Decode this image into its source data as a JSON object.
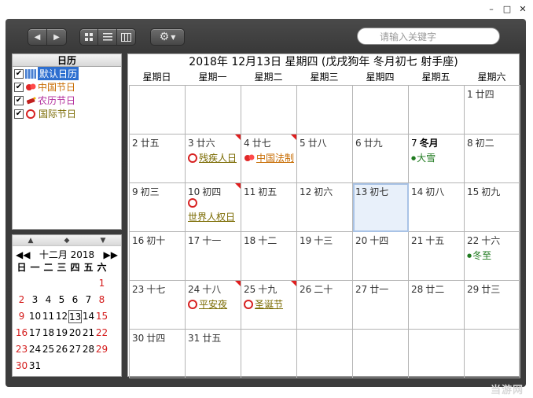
{
  "window": {
    "controls": [
      "–",
      "□",
      "✕"
    ]
  },
  "toolbar": {
    "search_placeholder": "请输入关键字"
  },
  "calendars": {
    "header": "日历",
    "items": [
      {
        "label": "默认日历",
        "color": "#ffffff",
        "selected": true
      },
      {
        "label": "中国节日",
        "color": "#c76b00",
        "selected": false
      },
      {
        "label": "农历节日",
        "color": "#b3309e",
        "selected": false
      },
      {
        "label": "国际节日",
        "color": "#7a6a00",
        "selected": false
      }
    ]
  },
  "mini_calendar": {
    "month_label": "十二月 2018",
    "weekdays": [
      "日",
      "一",
      "二",
      "三",
      "四",
      "五",
      "六"
    ],
    "rows": [
      [
        "",
        "",
        "",
        "",
        "",
        "",
        "1"
      ],
      [
        "2",
        "3",
        "4",
        "5",
        "6",
        "7",
        "8"
      ],
      [
        "9",
        "10",
        "11",
        "12",
        "13",
        "14",
        "15"
      ],
      [
        "16",
        "17",
        "18",
        "19",
        "20",
        "21",
        "22"
      ],
      [
        "23",
        "24",
        "25",
        "26",
        "27",
        "28",
        "29"
      ],
      [
        "30",
        "31",
        "",
        "",
        "",
        "",
        ""
      ]
    ]
  },
  "main": {
    "title": "2018年 12月13日 星期四 (戊戌狗年 冬月初七 射手座)",
    "weekdays": [
      "星期日",
      "星期一",
      "星期二",
      "星期三",
      "星期四",
      "星期五",
      "星期六"
    ],
    "weeks": [
      [
        {
          "d": ""
        },
        {
          "d": ""
        },
        {
          "d": ""
        },
        {
          "d": ""
        },
        {
          "d": ""
        },
        {
          "d": ""
        },
        {
          "d": "1",
          "l": "廿四"
        }
      ],
      [
        {
          "d": "2",
          "l": "廿五"
        },
        {
          "d": "3",
          "l": "廿六",
          "event": "残疾人日",
          "etype": "intl",
          "corner": true
        },
        {
          "d": "4",
          "l": "廿七",
          "event": "中国法制",
          "etype": "cn",
          "corner": true
        },
        {
          "d": "5",
          "l": "廿八"
        },
        {
          "d": "6",
          "l": "廿九"
        },
        {
          "d": "7",
          "l": "冬月",
          "bold": true,
          "event": "大雪",
          "etype": "term"
        },
        {
          "d": "8",
          "l": "初二"
        }
      ],
      [
        {
          "d": "9",
          "l": "初三"
        },
        {
          "d": "10",
          "l": "初四",
          "event": "世界人权日",
          "etype": "intl2",
          "corner": true
        },
        {
          "d": "11",
          "l": "初五"
        },
        {
          "d": "12",
          "l": "初六"
        },
        {
          "d": "13",
          "l": "初七",
          "today": true
        },
        {
          "d": "14",
          "l": "初八"
        },
        {
          "d": "15",
          "l": "初九"
        }
      ],
      [
        {
          "d": "16",
          "l": "初十"
        },
        {
          "d": "17",
          "l": "十一"
        },
        {
          "d": "18",
          "l": "十二"
        },
        {
          "d": "19",
          "l": "十三"
        },
        {
          "d": "20",
          "l": "十四"
        },
        {
          "d": "21",
          "l": "十五"
        },
        {
          "d": "22",
          "l": "十六",
          "event": "冬至",
          "etype": "term"
        }
      ],
      [
        {
          "d": "23",
          "l": "十七"
        },
        {
          "d": "24",
          "l": "十八",
          "event": "平安夜",
          "etype": "intl",
          "corner": true
        },
        {
          "d": "25",
          "l": "十九",
          "event": "圣诞节",
          "etype": "intl",
          "corner": true
        },
        {
          "d": "26",
          "l": "二十"
        },
        {
          "d": "27",
          "l": "廿一"
        },
        {
          "d": "28",
          "l": "廿二"
        },
        {
          "d": "29",
          "l": "廿三"
        }
      ],
      [
        {
          "d": "30",
          "l": "廿四"
        },
        {
          "d": "31",
          "l": "廿五"
        },
        {
          "d": ""
        },
        {
          "d": ""
        },
        {
          "d": ""
        },
        {
          "d": ""
        },
        {
          "d": ""
        }
      ]
    ]
  },
  "watermark": "当游网"
}
